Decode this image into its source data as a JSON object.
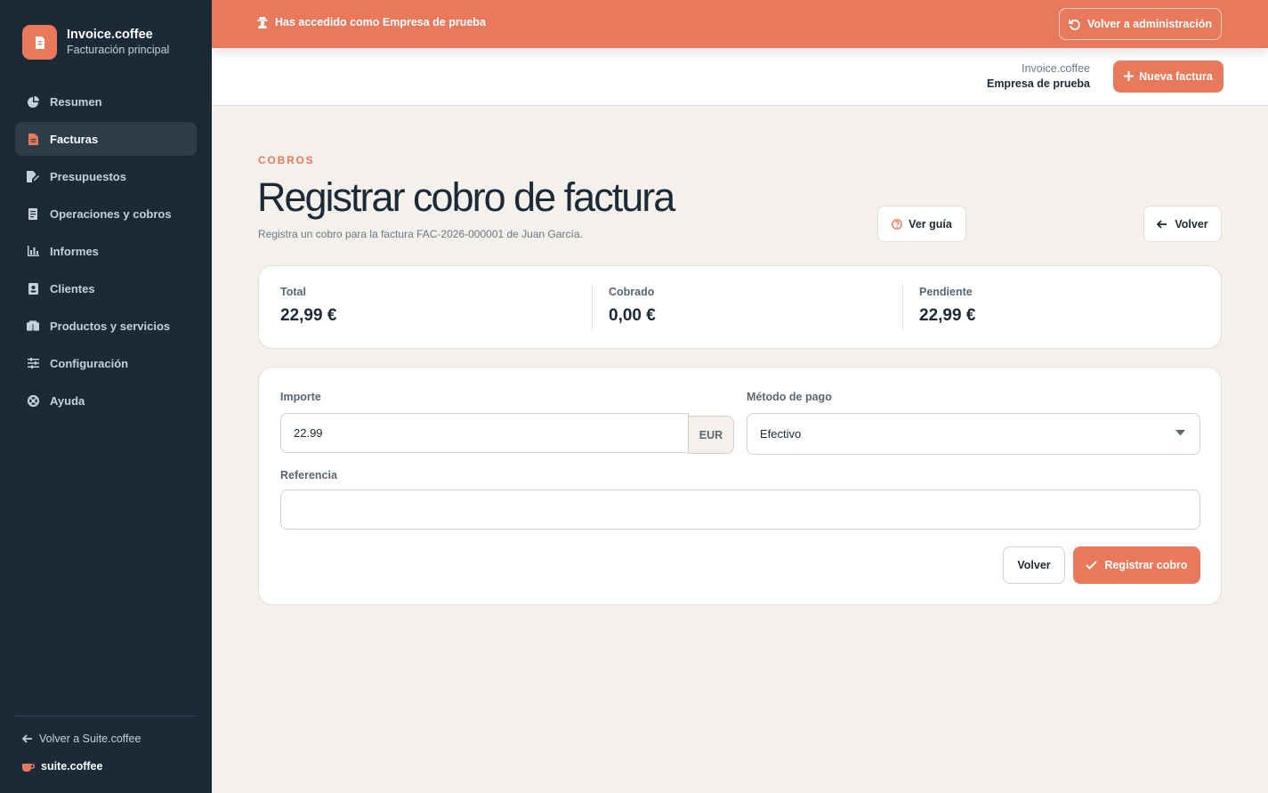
{
  "sidebar": {
    "brand_title": "Invoice.coffee",
    "brand_subtitle": "Facturación principal",
    "items": [
      {
        "label": "Resumen",
        "icon": "pie-chart-icon"
      },
      {
        "label": "Facturas",
        "icon": "invoice-icon",
        "active": true
      },
      {
        "label": "Presupuestos",
        "icon": "file-edit-icon"
      },
      {
        "label": "Operaciones y cobros",
        "icon": "receipt-icon"
      },
      {
        "label": "Informes",
        "icon": "bar-chart-icon"
      },
      {
        "label": "Clientes",
        "icon": "contact-card-icon"
      },
      {
        "label": "Productos y servicios",
        "icon": "boxes-icon"
      },
      {
        "label": "Configuración",
        "icon": "sliders-icon"
      },
      {
        "label": "Ayuda",
        "icon": "lifebuoy-icon"
      }
    ],
    "back_suite_label": "Volver a Suite.coffee",
    "suite_brand": "suite.coffee"
  },
  "banner": {
    "message": "Has accedido como Empresa de prueba",
    "return_label": "Volver a administración"
  },
  "header": {
    "app_name": "Invoice.coffee",
    "company_name": "Empresa de prueba",
    "new_invoice_label": "Nueva factura"
  },
  "page": {
    "eyebrow": "COBROS",
    "title": "Registrar cobro de factura",
    "subtitle": "Registra un cobro para la factura FAC-2026-000001 de Juan García.",
    "guide_label": "Ver guía",
    "back_label": "Volver"
  },
  "summary": {
    "total_label": "Total",
    "total_value": "22,99 €",
    "collected_label": "Cobrado",
    "collected_value": "0,00 €",
    "pending_label": "Pendiente",
    "pending_value": "22,99 €"
  },
  "form": {
    "amount_label": "Importe",
    "amount_value": "22.99",
    "currency": "EUR",
    "method_label": "Método de pago",
    "method_value": "Efectivo",
    "reference_label": "Referencia",
    "reference_value": "",
    "cancel_label": "Volver",
    "submit_label": "Registrar cobro"
  },
  "colors": {
    "accent": "#e8795c",
    "sidebar_bg": "#1b2a36",
    "page_bg": "#f4f1ec"
  }
}
